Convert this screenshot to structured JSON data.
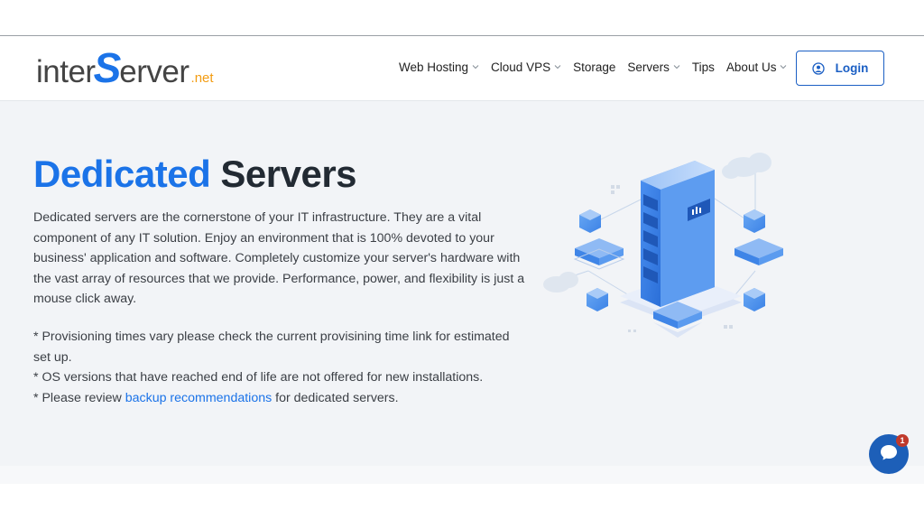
{
  "brand": {
    "logo_part1": "inter",
    "logo_s": "S",
    "logo_part2": "erver",
    "logo_tld": ".net"
  },
  "nav": {
    "items": [
      {
        "label": "Web Hosting",
        "has_dropdown": true
      },
      {
        "label": "Cloud VPS",
        "has_dropdown": true
      },
      {
        "label": "Storage",
        "has_dropdown": false
      },
      {
        "label": "Servers",
        "has_dropdown": true
      },
      {
        "label": "Tips",
        "has_dropdown": false
      },
      {
        "label": "About Us",
        "has_dropdown": true
      }
    ],
    "login_label": "Login"
  },
  "hero": {
    "title_highlight": "Dedicated",
    "title_rest": "Servers",
    "description": "Dedicated servers are the cornerstone of your IT infrastructure. They are a vital component of any IT solution. Enjoy an environment that is 100% devoted to your business' application and software. Completely customize your server's hardware with the vast array of resources that we provide. Performance, power, and flexibility is just a mouse click away.",
    "note1": "* Provisioning times vary please check the current provisining time link for estimated set up.",
    "note2": "* OS versions that have reached end of life are not offered for new installations.",
    "note3_prefix": "* Please review ",
    "note3_link": "backup recommendations",
    "note3_suffix": " for dedicated servers."
  },
  "chat": {
    "badge_count": "1"
  },
  "colors": {
    "brand_blue": "#1b73e8",
    "login_blue": "#1b5fc4",
    "accent_orange": "#f39c12",
    "hero_bg": "#f2f4f7",
    "chat_blue": "#1d5fb8",
    "badge_red": "#c0392b"
  }
}
